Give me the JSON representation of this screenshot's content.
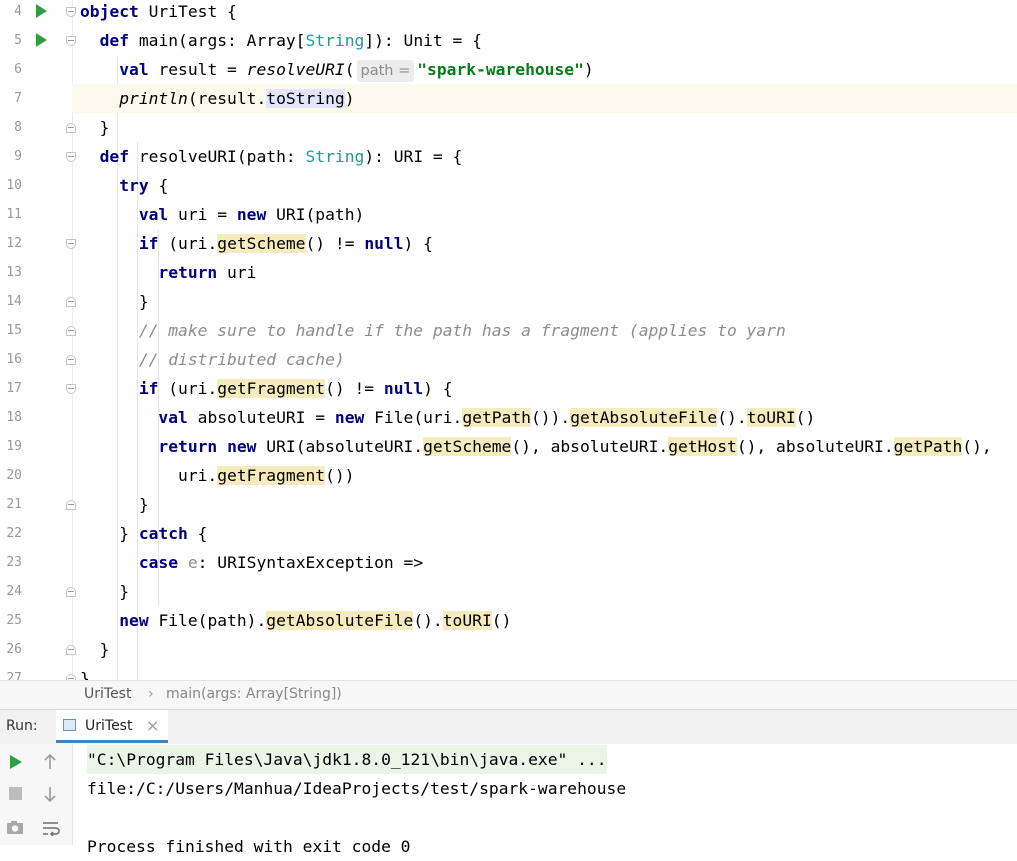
{
  "editor": {
    "lines": [
      {
        "n": "4",
        "html": "<span class=\"kw\">object</span> UriTest {"
      },
      {
        "n": "5",
        "html": "  <span class=\"kw\">def</span> main(args: Array[<span class=\"ty\">String</span>]): Unit = {"
      },
      {
        "n": "6",
        "html": "    <span class=\"kw\">val</span> result = <span class=\"it\">resolveURI</span>(<span class=\"hint\">path =</span><span class=\"st\">\"spark-warehouse\"</span>)"
      },
      {
        "n": "7",
        "html": "    <span class=\"it\">println</span>(result.<span class=\"hs\">toString</span>)"
      },
      {
        "n": "8",
        "html": "  }"
      },
      {
        "n": "9",
        "html": "  <span class=\"kw\">def</span> resolveURI(path: <span class=\"ty\">String</span>): URI = {"
      },
      {
        "n": "10",
        "html": "    <span class=\"kw\">try</span> {"
      },
      {
        "n": "11",
        "html": "      <span class=\"kw\">val</span> uri = <span class=\"kw\">new</span> URI(path)"
      },
      {
        "n": "12",
        "html": "      <span class=\"kw\">if</span> (uri.<span class=\"hl\">getScheme</span>() != <span class=\"kw\">null</span>) {"
      },
      {
        "n": "13",
        "html": "        <span class=\"kw\">return</span> uri"
      },
      {
        "n": "14",
        "html": "      }"
      },
      {
        "n": "15",
        "html": "      <span class=\"cm\">// make sure to handle if the path has a fragment (applies to yarn</span>"
      },
      {
        "n": "16",
        "html": "      <span class=\"cm\">// distributed cache)</span>"
      },
      {
        "n": "17",
        "html": "      <span class=\"kw\">if</span> (uri.<span class=\"hl\">getFragment</span>() != <span class=\"kw\">null</span>) {"
      },
      {
        "n": "18",
        "html": "        <span class=\"kw\">val</span> absoluteURI = <span class=\"kw\">new</span> File(uri.<span class=\"hl\">getPath</span>()).<span class=\"hl\">getAbsoluteFile</span>().<span class=\"hl\">toURI</span>()"
      },
      {
        "n": "19",
        "html": "        <span class=\"kw\">return</span> <span class=\"kw\">new</span> URI(absoluteURI.<span class=\"hl\">getScheme</span>(), absoluteURI.<span class=\"hl\">getHost</span>(), absoluteURI.<span class=\"hl\">getPath</span>(),"
      },
      {
        "n": "20",
        "html": "          uri.<span class=\"hl\">getFragment</span>())"
      },
      {
        "n": "21",
        "html": "      }"
      },
      {
        "n": "22",
        "html": "    } <span class=\"kw\">catch</span> {"
      },
      {
        "n": "23",
        "html": "      <span class=\"kw\">case</span> <span class=\"pm\">e</span>: URISyntaxException =>"
      },
      {
        "n": "24",
        "html": "    }"
      },
      {
        "n": "25",
        "html": "    <span class=\"kw\">new</span> File(path).<span class=\"hl\">getAbsoluteFile</span>().<span class=\"hl\">toURI</span>()"
      },
      {
        "n": "26",
        "html": "  }"
      },
      {
        "n": "27",
        "html": "}"
      }
    ]
  },
  "breadcrumb": {
    "object": "UriTest",
    "separator": "›",
    "method": "main(args: Array[String])"
  },
  "run_panel": {
    "label": "Run:",
    "tab_label": "UriTest",
    "tab_close": "×",
    "output": [
      "\"C:\\Program Files\\Java\\jdk1.8.0_121\\bin\\java.exe\" ...",
      "file:/C:/Users/Manhua/IdeaProjects/test/spark-warehouse",
      "",
      "Process finished with exit code 0"
    ]
  },
  "icons": {
    "run": "run-triangle-icon",
    "stop": "stop-icon",
    "camera": "camera-icon",
    "up": "arrow-up-icon",
    "down": "arrow-down-icon",
    "wrap": "soft-wrap-icon",
    "tab": "run-config-icon"
  },
  "colors": {
    "keyword": "#000080",
    "string": "#067d17",
    "type": "#20999d",
    "comment": "#8c8c8c",
    "usage_highlight": "#f6ebbc",
    "caret_line": "#fcfaed",
    "run_green": "#2ea043",
    "tab_underline": "#4083c9"
  }
}
